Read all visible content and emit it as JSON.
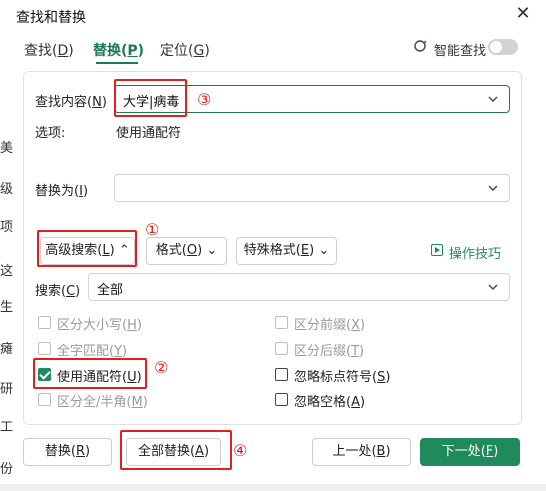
{
  "window": {
    "title": "查找和替换",
    "close_label": "✕"
  },
  "tabs": [
    {
      "label": "查找",
      "key": "D"
    },
    {
      "label": "替换",
      "key": "P"
    },
    {
      "label": "定位",
      "key": "G"
    }
  ],
  "smart_search": {
    "label": "智能查找",
    "enabled": false
  },
  "find": {
    "label": "查找内容",
    "key": "N",
    "value": "大学|病毒"
  },
  "options": {
    "label": "选项:",
    "value": "使用通配符"
  },
  "replace": {
    "label": "替换为",
    "key": "I",
    "value": ""
  },
  "toolbar": {
    "advanced": {
      "label": "高级搜索",
      "key": "L"
    },
    "format": {
      "label": "格式",
      "key": "O"
    },
    "special": {
      "label": "特殊格式",
      "key": "E"
    },
    "tips": "操作技巧"
  },
  "search_scope": {
    "label": "搜索",
    "key": "C",
    "value": "全部"
  },
  "checkboxes": {
    "match_case": {
      "label": "区分大小写",
      "key": "H",
      "checked": false,
      "enabled": false
    },
    "whole_word": {
      "label": "全字匹配",
      "key": "Y",
      "checked": false,
      "enabled": false
    },
    "wildcard": {
      "label": "使用通配符",
      "key": "U",
      "checked": true,
      "enabled": true
    },
    "width": {
      "label": "区分全/半角",
      "key": "M",
      "checked": false,
      "enabled": false
    },
    "prefix": {
      "label": "区分前缀",
      "key": "X",
      "checked": false,
      "enabled": false
    },
    "suffix": {
      "label": "区分后缀",
      "key": "T",
      "checked": false,
      "enabled": false
    },
    "ignore_punct": {
      "label": "忽略标点符号",
      "key": "S",
      "checked": false,
      "enabled": true
    },
    "ignore_space": {
      "label": "忽略空格",
      "key": "A",
      "checked": false,
      "enabled": true
    }
  },
  "buttons": {
    "replace": {
      "label": "替换",
      "key": "R"
    },
    "replace_all": {
      "label": "全部替换",
      "key": "A"
    },
    "previous": {
      "label": "上一处",
      "key": "B"
    },
    "next": {
      "label": "下一处",
      "key": "F"
    }
  },
  "annotations": [
    "①",
    "②",
    "③",
    "④"
  ],
  "background_text": [
    "美",
    "级",
    "项",
    "这",
    "生",
    "瘫",
    "研",
    "工",
    "份"
  ],
  "colors": {
    "accent": "#1f8a5b",
    "annotation": "#e02020"
  }
}
